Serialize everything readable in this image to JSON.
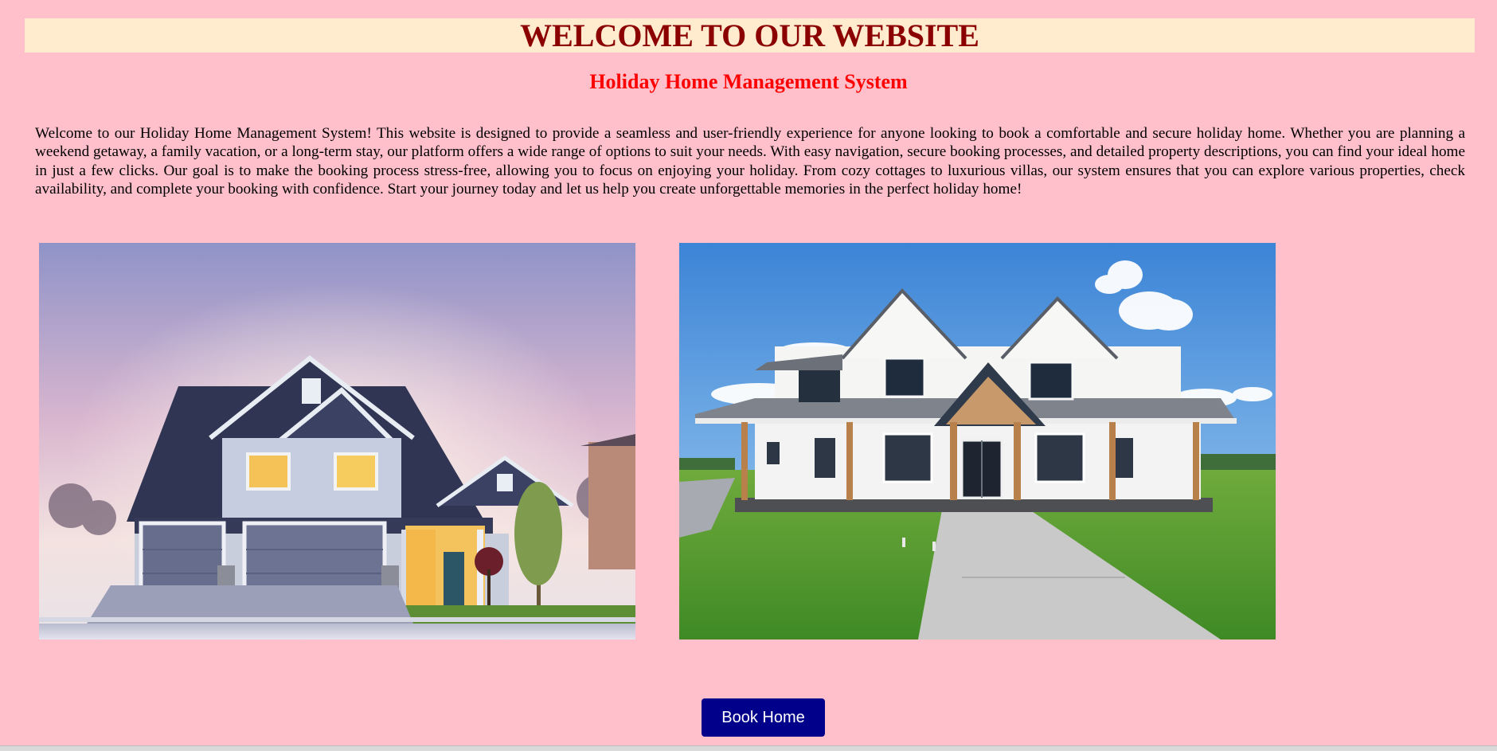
{
  "header": {
    "title": "WELCOME TO OUR WEBSITE"
  },
  "subtitle": "Holiday Home Management System",
  "intro": "Welcome to our Holiday Home Management System! This website is designed to provide a seamless and user-friendly experience for anyone looking to book a comfortable and secure holiday home. Whether you are planning a weekend getaway, a family vacation, or a long-term stay, our platform offers a wide range of options to suit your needs. With easy navigation, secure booking processes, and detailed property descriptions, you can find your ideal home in just a few clicks. Our goal is to make the booking process stress-free, allowing you to focus on enjoying your holiday. From cozy cottages to luxurious villas, our system ensures that you can explore various properties, check availability, and complete your booking with confidence. Start your journey today and let us help you create unforgettable memories in the perfect holiday home!",
  "actions": {
    "book_label": "Book Home"
  },
  "colors": {
    "page_bg": "#FFC0CB",
    "banner_bg": "#FFEBCD",
    "title": "#8B0000",
    "subtitle": "#FF0000",
    "button_bg": "#00008B"
  }
}
